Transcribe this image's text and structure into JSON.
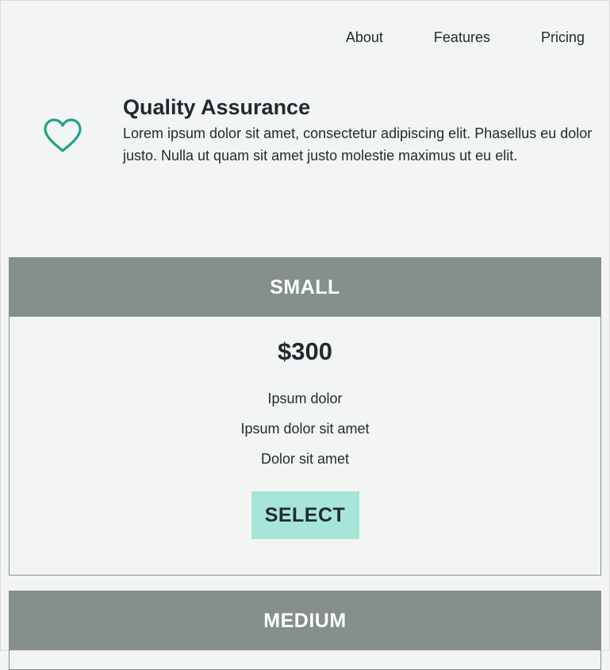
{
  "nav": {
    "items": [
      {
        "label": "About"
      },
      {
        "label": "Features"
      },
      {
        "label": "Pricing"
      }
    ]
  },
  "feature": {
    "icon": "heart-icon",
    "icon_color": "#1fa38a",
    "title": "Quality Assurance",
    "description": "Lorem ipsum dolor sit amet, consectetur adipiscing elit. Phasellus eu dolor justo. Nulla ut quam sit amet justo molestie maximus ut eu elit."
  },
  "pricing": {
    "cards": [
      {
        "name": "SMALL",
        "price": "$300",
        "features": [
          "Ipsum dolor",
          "Ipsum dolor sit amet",
          "Dolor sit amet"
        ],
        "button_label": "SELECT"
      },
      {
        "name": "MEDIUM"
      }
    ]
  },
  "colors": {
    "header_bg": "#858f8e",
    "button_bg": "#a6e5d8",
    "page_bg": "#f3f5f4",
    "text": "#1f2a30"
  }
}
